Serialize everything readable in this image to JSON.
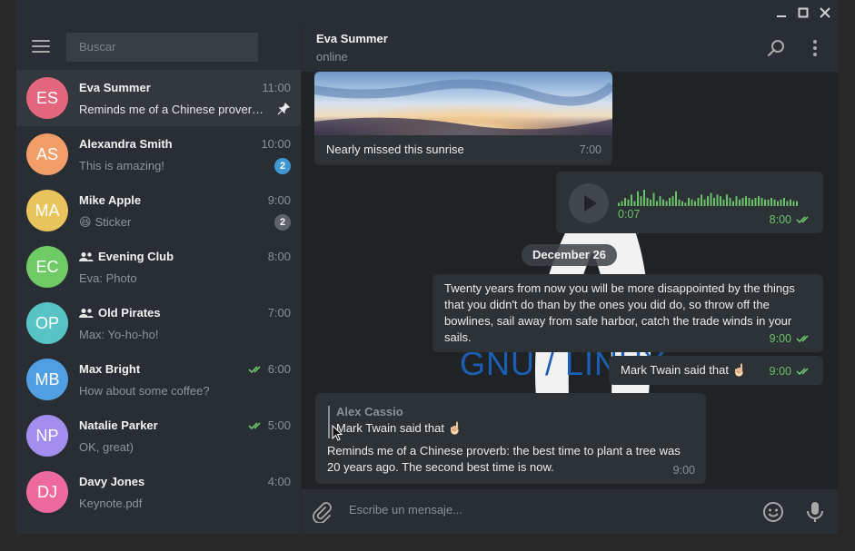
{
  "window": {
    "minimize": "minimize",
    "maximize": "maximize",
    "close": "close"
  },
  "search": {
    "placeholder": "Buscar"
  },
  "dialogs": [
    {
      "initials": "ES",
      "color": "#e3667d",
      "name": "Eva Summer",
      "time": "11:00",
      "message": "Reminds me of a Chinese prover…",
      "pinned": true,
      "active": true
    },
    {
      "initials": "AS",
      "color": "#f29e68",
      "name": "Alexandra Smith",
      "time": "10:00",
      "message": "This is amazing!",
      "badge": "2",
      "badge_color": "blue"
    },
    {
      "initials": "MA",
      "color": "#e9c45d",
      "name": "Mike Apple",
      "time": "9:00",
      "emoji": "😆",
      "message": "Sticker",
      "badge": "2",
      "badge_color": "gray"
    },
    {
      "initials": "EC",
      "color": "#6fcb65",
      "name": "Evening Club",
      "time": "8:00",
      "message": "Eva: Photo",
      "group": true
    },
    {
      "initials": "OP",
      "color": "#58c4c6",
      "name": "Old Pirates",
      "time": "7:00",
      "message": "Max: Yo-ho-ho!",
      "group": true
    },
    {
      "initials": "MB",
      "color": "#4f9fe2",
      "name": "Max Bright",
      "time": "6:00",
      "message": "How about some coffee?",
      "read": true
    },
    {
      "initials": "NP",
      "color": "#a38ef0",
      "name": "Natalie Parker",
      "time": "5:00",
      "message": "OK, great)",
      "read": true
    },
    {
      "initials": "DJ",
      "color": "#ee6a9c",
      "name": "Davy Jones",
      "time": "4:00",
      "message": "Keynote.pdf"
    }
  ],
  "chat": {
    "peer_name": "Eva Summer",
    "peer_status": "online",
    "background_text": "GNU / LINUX",
    "messages": {
      "photo_caption": "Nearly missed this sunrise",
      "photo_time": "7:00",
      "voice_duration": "0:07",
      "voice_time": "8:00",
      "voice_levels": [
        0.2,
        0.3,
        0.5,
        0.4,
        0.7,
        0.3,
        0.9,
        0.6,
        1.0,
        0.5,
        0.4,
        0.8,
        0.3,
        0.6,
        0.4,
        0.3,
        0.5,
        0.6,
        0.9,
        0.4,
        0.3,
        0.2,
        0.5,
        0.4,
        0.3,
        0.5,
        0.7,
        0.4,
        0.6,
        0.8,
        0.5,
        0.7,
        0.6,
        0.4,
        0.7,
        0.5,
        0.3,
        0.6,
        0.4,
        0.5,
        0.6,
        0.5,
        0.4,
        0.5,
        0.6,
        0.5,
        0.4,
        0.4,
        0.5,
        0.4,
        0.3,
        0.4,
        0.5,
        0.3,
        0.4,
        0.3,
        0.3
      ],
      "date": "December 26",
      "quote_text": "Twenty years from now you will be more disappointed by the things that you didn't do than by the ones you did do, so throw off the bowlines, sail away from safe harbor, catch the trade winds in your sails.",
      "quote_time": "9:00",
      "twain_text": "Mark Twain said that ☝🏻",
      "twain_time": "9:00",
      "reply_author": "Alex Cassio",
      "reply_quote": "Mark Twain said that ☝🏻",
      "reply_text": "Reminds me of a Chinese proverb: the best time to plant a tree was 20 years ago. The second best time is now.",
      "reply_time": "9:00"
    },
    "composer_placeholder": "Escribe un mensaje..."
  }
}
